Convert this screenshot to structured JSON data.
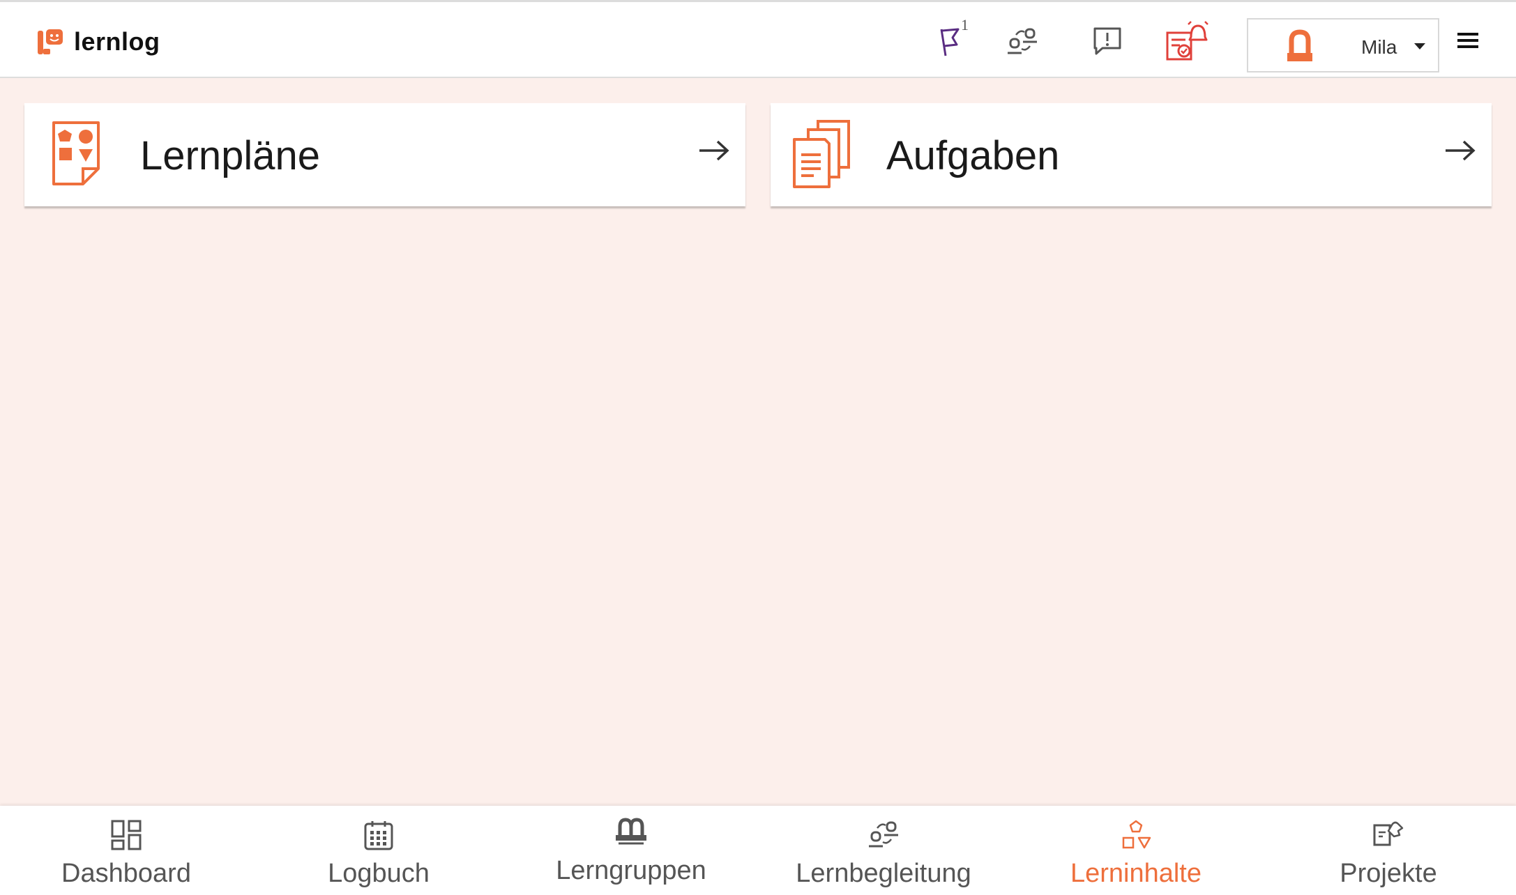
{
  "app": {
    "name": "lernlog"
  },
  "header": {
    "flag_count": "1",
    "user": {
      "name": "Mila"
    }
  },
  "cards": [
    {
      "label": "Lernpläne",
      "icon": "learning-plan-icon"
    },
    {
      "label": "Aufgaben",
      "icon": "tasks-documents-icon"
    }
  ],
  "bottom_nav": [
    {
      "label": "Dashboard",
      "icon": "dashboard-icon",
      "active": false
    },
    {
      "label": "Logbuch",
      "icon": "calendar-icon",
      "active": false
    },
    {
      "label": "Lerngruppen",
      "icon": "group-icon",
      "active": false
    },
    {
      "label": "Lernbegleitung",
      "icon": "mentoring-icon",
      "active": false
    },
    {
      "label": "Lerninhalte",
      "icon": "shapes-icon",
      "active": true
    },
    {
      "label": "Projekte",
      "icon": "project-puzzle-icon",
      "active": false
    }
  ],
  "colors": {
    "accent": "#ee6f3c",
    "background": "#fcefeb",
    "flag": "#5a2d82",
    "alert": "#e0403a"
  }
}
